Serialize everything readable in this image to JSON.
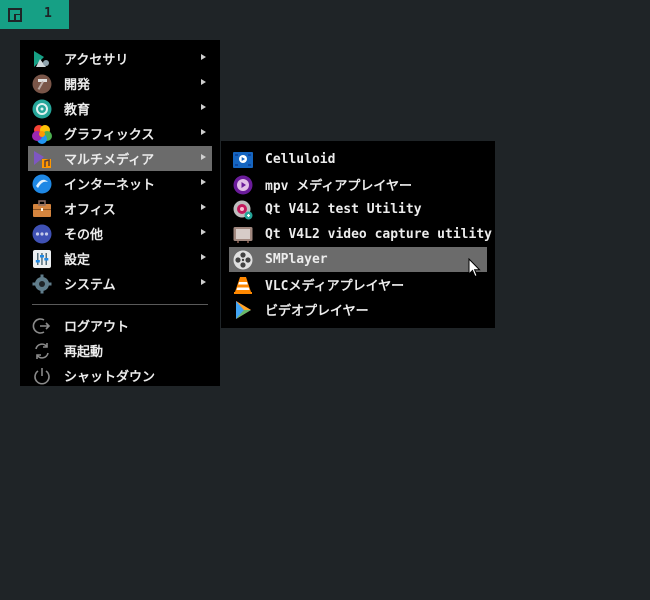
{
  "panel": {
    "workspace": "1"
  },
  "main_menu": {
    "items": [
      {
        "label": "アクセサリ",
        "icon": "accessories-icon",
        "submenu": true
      },
      {
        "label": "開発",
        "icon": "development-icon",
        "submenu": true
      },
      {
        "label": "教育",
        "icon": "education-icon",
        "submenu": true
      },
      {
        "label": "グラフィックス",
        "icon": "graphics-icon",
        "submenu": true
      },
      {
        "label": "マルチメディア",
        "icon": "multimedia-icon",
        "submenu": true,
        "active": true
      },
      {
        "label": "インターネット",
        "icon": "internet-icon",
        "submenu": true
      },
      {
        "label": "オフィス",
        "icon": "office-icon",
        "submenu": true
      },
      {
        "label": "その他",
        "icon": "other-icon",
        "submenu": true
      },
      {
        "label": "設定",
        "icon": "settings-icon",
        "submenu": true
      },
      {
        "label": "システム",
        "icon": "system-icon",
        "submenu": true
      }
    ],
    "session": [
      {
        "label": "ログアウト",
        "icon": "logout-icon"
      },
      {
        "label": "再起動",
        "icon": "reboot-icon"
      },
      {
        "label": "シャットダウン",
        "icon": "shutdown-icon"
      }
    ]
  },
  "sub_menu": {
    "items": [
      {
        "label": "Celluloid",
        "icon": "celluloid-icon"
      },
      {
        "label": "mpv メディアプレイヤー",
        "icon": "mpv-icon"
      },
      {
        "label": "Qt V4L2 test Utility",
        "icon": "qv4l2-test-icon"
      },
      {
        "label": "Qt V4L2 video capture utility",
        "icon": "qv4l2-capture-icon"
      },
      {
        "label": "SMPlayer",
        "icon": "smplayer-icon",
        "active": true
      },
      {
        "label": "VLCメディアプレイヤー",
        "icon": "vlc-icon"
      },
      {
        "label": "ビデオプレイヤー",
        "icon": "video-player-icon"
      }
    ]
  },
  "colors": {
    "accent": "#16a085",
    "highlight": "#6b6b6b",
    "menu_bg": "#000000",
    "desktop": "#1f2427"
  }
}
